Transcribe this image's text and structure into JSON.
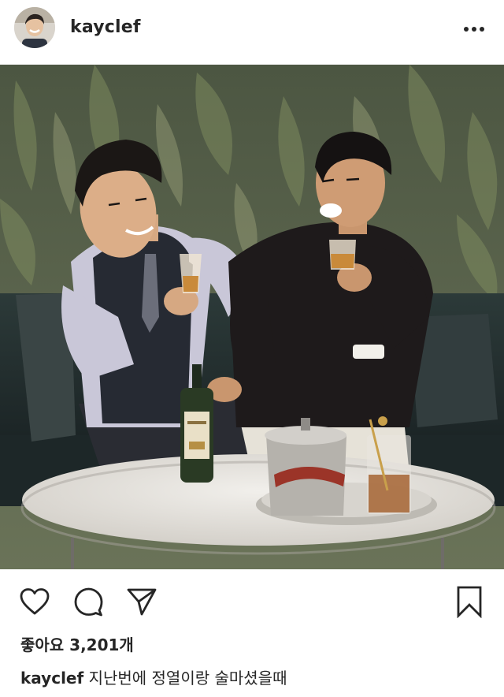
{
  "post": {
    "username": "kayclef",
    "likes_text": "좋아요 3,201개",
    "caption": {
      "username": "kayclef",
      "text": "지난번에 정열이랑 술마셨을때"
    }
  },
  "icons": {
    "more": "more-horizontal-icon",
    "like": "heart-icon",
    "comment": "comment-icon",
    "share": "send-icon",
    "save": "bookmark-icon"
  },
  "colors": {
    "text": "#262626",
    "background": "#ffffff"
  }
}
